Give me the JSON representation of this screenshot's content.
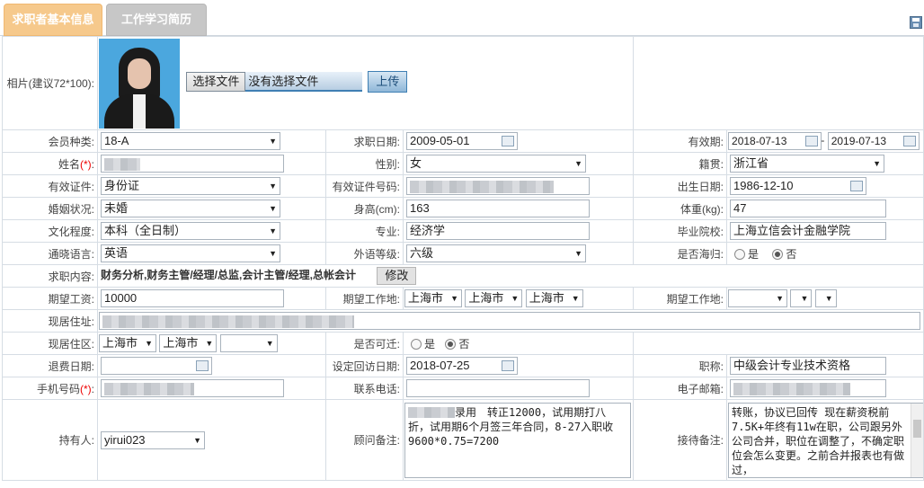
{
  "tabs": {
    "basic": "求职者基本信息",
    "history": "工作学习简历"
  },
  "photo": {
    "label": "相片(建议72*100):",
    "choose_btn": "选择文件",
    "no_file": "没有选择文件",
    "upload_btn": "上传"
  },
  "member_type": {
    "label": "会员种类:",
    "value": "18-A"
  },
  "apply_date": {
    "label": "求职日期:",
    "value": "2009-05-01"
  },
  "valid_period": {
    "label": "有效期:",
    "from": "2018-07-13",
    "sep": "-",
    "to": "2019-07-13"
  },
  "name": {
    "label": "姓名",
    "req": "(*)",
    "colon": ":"
  },
  "gender": {
    "label": "性别:",
    "value": "女"
  },
  "hometown": {
    "label": "籍贯:",
    "value": "浙江省"
  },
  "id_type": {
    "label": "有效证件:",
    "value": "身份证"
  },
  "id_no": {
    "label": "有效证件号码:"
  },
  "birth": {
    "label": "出生日期:",
    "value": "1986-12-10"
  },
  "marriage": {
    "label": "婚姻状况:",
    "value": "未婚"
  },
  "height": {
    "label": "身高(cm):",
    "value": "163"
  },
  "weight": {
    "label": "体重(kg):",
    "value": "47"
  },
  "education": {
    "label": "文化程度:",
    "value": "本科（全日制）"
  },
  "major": {
    "label": "专业:",
    "value": "经济学"
  },
  "school": {
    "label": "毕业院校:",
    "value": "上海立信会计金融学院"
  },
  "language": {
    "label": "通晓语言:",
    "value": "英语"
  },
  "lang_level": {
    "label": "外语等级:",
    "value": "六级"
  },
  "returnee": {
    "label": "是否海归:",
    "yes": "是",
    "no": "否"
  },
  "job_content": {
    "label": "求职内容:",
    "value": "财务分析,财务主管/经理/总监,会计主管/经理,总帐会计",
    "modify_btn": "修改"
  },
  "salary": {
    "label": "期望工资:",
    "value": "10000"
  },
  "work_place": {
    "label": "期望工作地:",
    "p1": "上海市",
    "p2": "上海市",
    "p3": "上海市"
  },
  "work_place2": {
    "label": "期望工作地:"
  },
  "address": {
    "label": "现居住址:"
  },
  "district": {
    "label": "现居住区:",
    "p1": "上海市",
    "p2": "上海市"
  },
  "relocate": {
    "label": "是否可迁:",
    "yes": "是",
    "no": "否"
  },
  "refund_date": {
    "label": "退费日期:"
  },
  "visit_date": {
    "label": "设定回访日期:",
    "value": "2018-07-25"
  },
  "title": {
    "label": "职称:",
    "value": "中级会计专业技术资格"
  },
  "mobile": {
    "label": "手机号码",
    "req": "(*)",
    "colon": ":"
  },
  "phone": {
    "label": "联系电话:"
  },
  "email": {
    "label": "电子邮箱:"
  },
  "holder": {
    "label": "持有人:",
    "value": "yirui023"
  },
  "consultant_note": {
    "label": "顾问备注:",
    "text": "录用　转正12000，试用期打八折，试用期6个月签三年合同，8-27入职收9600*0.75=7200"
  },
  "reception_note": {
    "label": "接待备注:",
    "text": "转账，协议已回传 现在薪资税前7.5K+年终有11w在职，公司跟另外公司合并，职位在调整了，不确定职位会怎么变更。之前合并报表也有做过，"
  }
}
